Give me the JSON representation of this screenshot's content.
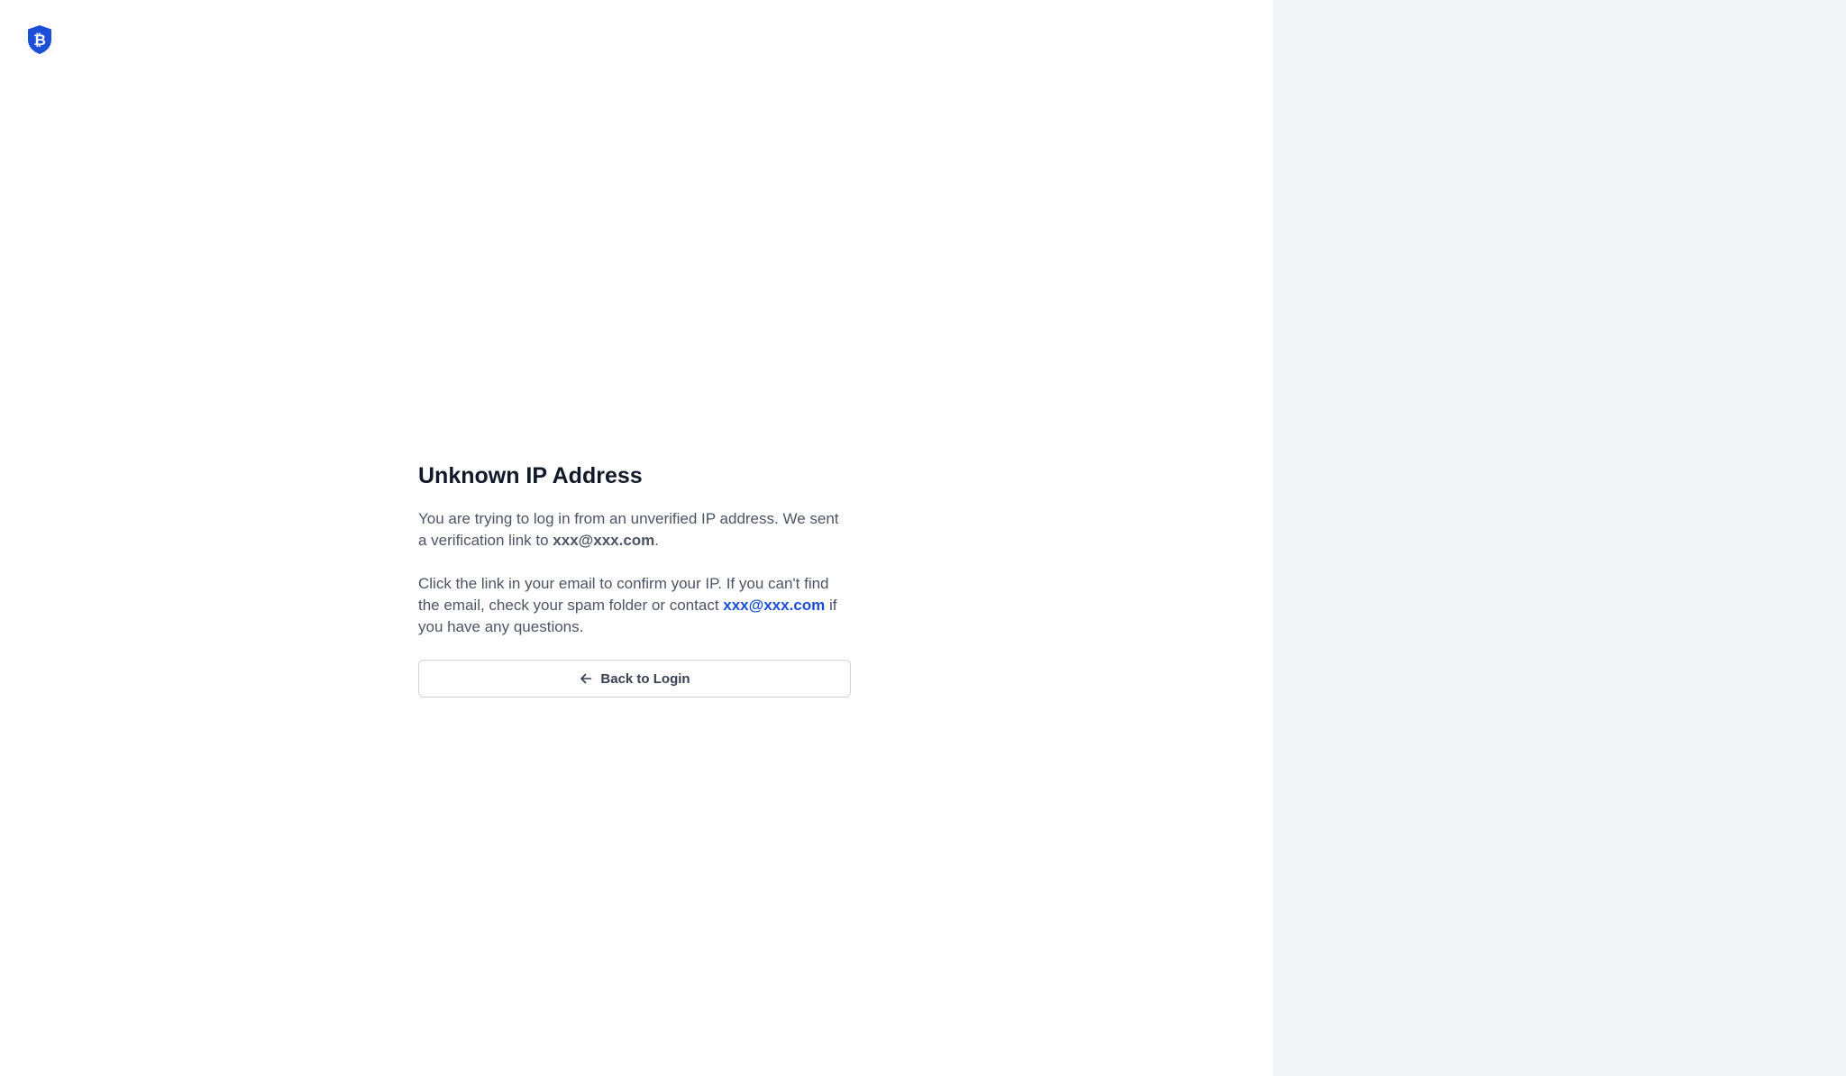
{
  "logo": {
    "name": "shield-bitcoin-logo",
    "color": "#1d4ed8",
    "glyph": "₿"
  },
  "main": {
    "title": "Unknown IP Address",
    "paragraph1": {
      "before": "You are trying to log in from an unverified IP address. We sent a verification link to ",
      "email": "xxx@xxx.com",
      "after": "."
    },
    "paragraph2": {
      "before": "Click the link in your email to confirm your IP. If you can't find the email, check your spam folder or contact ",
      "contact_email": "xxx@xxx.com",
      "after": " if you have any questions."
    },
    "back_button": {
      "icon": "arrow-left-icon",
      "label": "Back to Login"
    }
  },
  "colors": {
    "background": "#ffffff",
    "side_panel": "#f3f4f7",
    "heading": "#111827",
    "body_text": "#4b5563",
    "link": "#1d4ed8",
    "button_border": "#d1d5db"
  }
}
